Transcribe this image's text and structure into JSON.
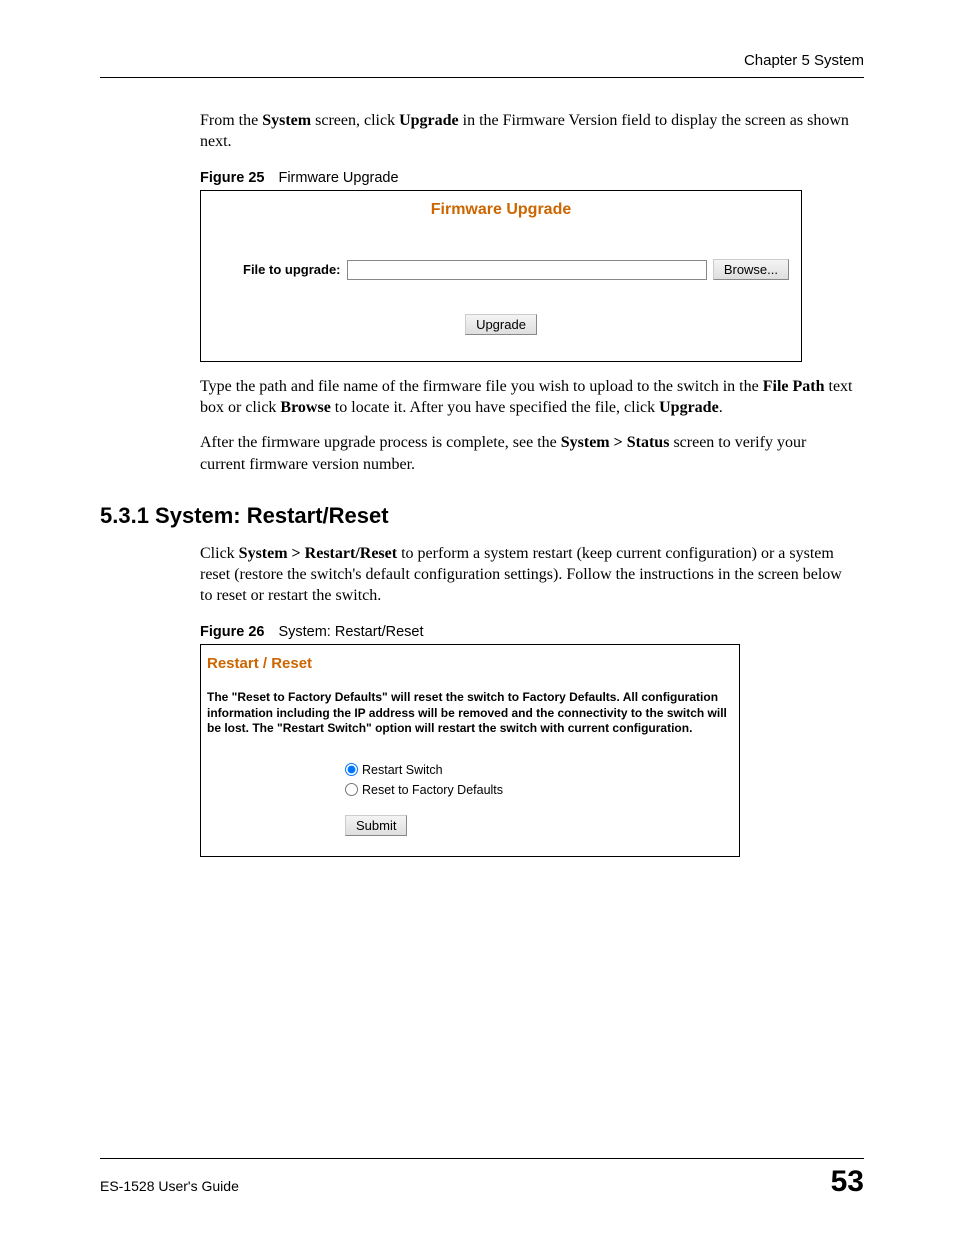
{
  "header": {
    "chapter": "Chapter 5 System"
  },
  "intro": {
    "p1_pre": "From the ",
    "p1_b1": "System",
    "p1_mid1": " screen, click ",
    "p1_b2": "Upgrade",
    "p1_post": " in the Firmware Version field to display the screen as shown next."
  },
  "fig25": {
    "caption_num": "Figure 25",
    "caption_text": "Firmware Upgrade",
    "panel_title": "Firmware Upgrade",
    "file_label": "File to upgrade:",
    "browse_btn": "Browse...",
    "upgrade_btn": "Upgrade"
  },
  "after_fig25": {
    "p1_pre": "Type the path and file name of the firmware file you wish to upload to the switch in the ",
    "p1_b1": "File Path",
    "p1_mid1": " text box or click ",
    "p1_b2": "Browse",
    "p1_mid2": " to locate it. After you have specified the file, click ",
    "p1_b3": "Upgrade",
    "p1_post": ".",
    "p2_pre": "After the firmware upgrade process is complete, see the ",
    "p2_b1": "System > Status",
    "p2_post": " screen to verify your current firmware version number."
  },
  "section531": {
    "heading": "5.3.1  System: Restart/Reset",
    "p_pre": "Click ",
    "p_b1": "System > Restart/Reset",
    "p_post": " to perform a system restart (keep current configuration) or a system reset (restore the switch's default configuration settings). Follow the instructions in the screen below to reset or restart the switch."
  },
  "fig26": {
    "caption_num": "Figure 26",
    "caption_text": "System: Restart/Reset",
    "panel_title": "Restart / Reset",
    "warning": "The \"Reset to Factory Defaults\" will reset the switch to Factory Defaults. All configuration information including the IP address will be removed and the connectivity to the switch will be lost. The \"Restart Switch\" option will restart the switch with current configuration.",
    "radio1": "Restart Switch",
    "radio2": "Reset to Factory Defaults",
    "submit_btn": "Submit"
  },
  "footer": {
    "guide": "ES-1528 User's Guide",
    "page": "53"
  }
}
